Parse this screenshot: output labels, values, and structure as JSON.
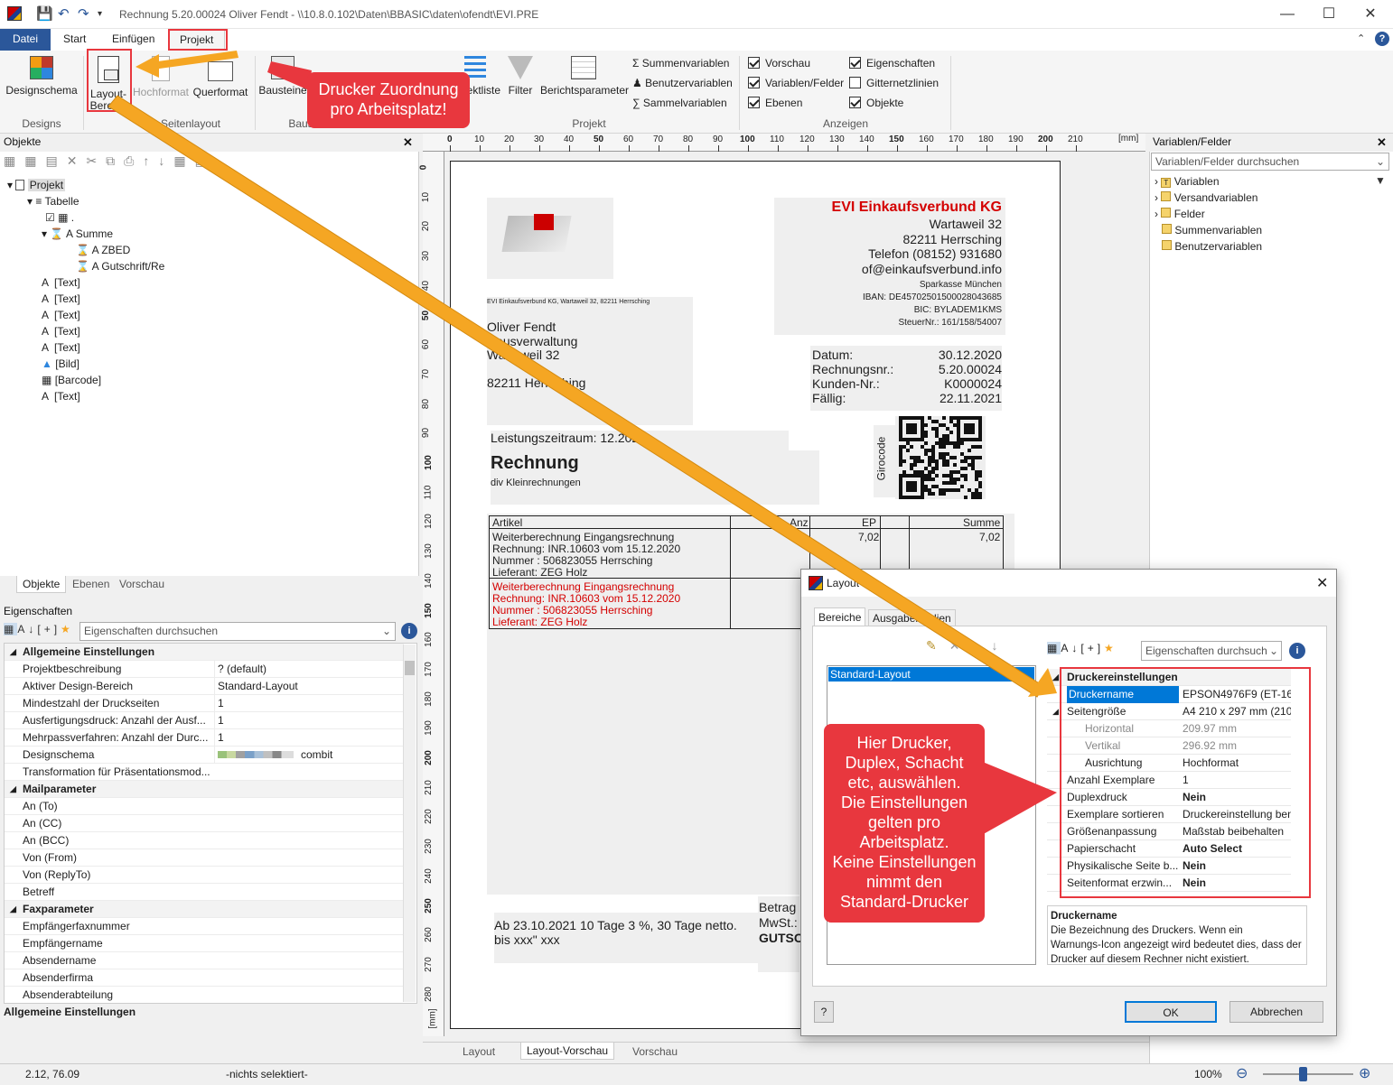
{
  "window": {
    "title": "Rechnung 5.20.00024 Oliver Fendt - \\\\10.8.0.102\\Daten\\BBASIC\\daten\\ofendt\\EVI.PRE",
    "min": "—",
    "max": "☐",
    "close": "✕",
    "help": "?"
  },
  "tabs": [
    "Datei",
    "Start",
    "Einfügen",
    "Projekt"
  ],
  "ribbon": {
    "designschema": "Designschema",
    "layout_line1": "Layout-",
    "layout_line2": "Bereich",
    "hochformat": "Hochformat",
    "querformat": "Querformat",
    "bausteine": "Bausteine",
    "objektliste": "Objektliste",
    "filter": "Filter",
    "berichtsparameter": "Berichtsparameter",
    "summenvariablen": "Summenvariablen",
    "benutzervariablen": "Benutzervariablen",
    "sammelvariablen": "Sammelvariablen",
    "vorschau": "Vorschau",
    "variablen_felder": "Variablen/Felder",
    "ebenen": "Ebenen",
    "eigenschaften": "Eigenschaften",
    "gitternetzlinien": "Gitternetzlinien",
    "objekte": "Objekte",
    "grp_designs": "Designs",
    "grp_seitenlayout": "Seitenlayout",
    "grp_bausteine": "Bausteine",
    "grp_projekt": "Projekt",
    "grp_anzeigen": "Anzeigen"
  },
  "callouts": {
    "top_line1": "Drucker Zuordnung",
    "top_line2": "pro Arbeitsplatz!",
    "dialog": [
      "Hier Drucker,",
      "Duplex, Schacht",
      "etc, auswählen.",
      "Die Einstellungen",
      "gelten pro",
      "Arbeitsplatz.",
      "Keine Einstellungen",
      "nimmt den",
      "Standard-Drucker"
    ]
  },
  "objects_panel": {
    "title": "Objekte",
    "tree": [
      {
        "label": "Projekt"
      },
      {
        "label": "Tabelle"
      },
      {
        "label": "."
      },
      {
        "label": "Summe"
      },
      {
        "label": "ZBED"
      },
      {
        "label": "Gutschrift/Re"
      },
      {
        "label": "[Text]"
      },
      {
        "label": "[Text]"
      },
      {
        "label": "[Text]"
      },
      {
        "label": "[Text]"
      },
      {
        "label": "[Text]"
      },
      {
        "label": "[Bild]"
      },
      {
        "label": "[Barcode]"
      },
      {
        "label": "[Text]"
      }
    ],
    "bottom_tabs": [
      "Objekte",
      "Ebenen",
      "Vorschau"
    ]
  },
  "properties": {
    "title": "Eigenschaften",
    "search_placeholder": "Eigenschaften durchsuchen",
    "rows": [
      {
        "k": "Allgemeine Einstellungen",
        "v": "",
        "cat": true
      },
      {
        "k": "Projektbeschreibung",
        "v": "? (default)"
      },
      {
        "k": "Aktiver Design-Bereich",
        "v": "Standard-Layout"
      },
      {
        "k": "Mindestzahl der Druckseiten",
        "v": "1"
      },
      {
        "k": "Ausfertigungsdruck: Anzahl der Ausf...",
        "v": "1"
      },
      {
        "k": "Mehrpassverfahren: Anzahl der Durc...",
        "v": "1"
      },
      {
        "k": "Designschema",
        "v": "combit"
      },
      {
        "k": "Transformation für Präsentationsmod...",
        "v": ""
      },
      {
        "k": "Mailparameter",
        "v": "",
        "cat": true
      },
      {
        "k": "An (To)",
        "v": ""
      },
      {
        "k": "An (CC)",
        "v": ""
      },
      {
        "k": "An (BCC)",
        "v": ""
      },
      {
        "k": "Von (From)",
        "v": ""
      },
      {
        "k": "Von (ReplyTo)",
        "v": ""
      },
      {
        "k": "Betreff",
        "v": ""
      },
      {
        "k": "Faxparameter",
        "v": "",
        "cat": true
      },
      {
        "k": "Empfängerfaxnummer",
        "v": ""
      },
      {
        "k": "Empfängername",
        "v": ""
      },
      {
        "k": "Absendername",
        "v": ""
      },
      {
        "k": "Absenderfirma",
        "v": ""
      },
      {
        "k": "Absenderabteilung",
        "v": ""
      }
    ],
    "footer": "Allgemeine Einstellungen"
  },
  "ruler": {
    "h_ticks": [
      "0",
      "10",
      "20",
      "30",
      "40",
      "50",
      "60",
      "70",
      "80",
      "90",
      "100",
      "110",
      "120",
      "130",
      "140",
      "150",
      "160",
      "170",
      "180",
      "190",
      "200",
      "210"
    ],
    "h_unit": "[mm]",
    "v_ticks": [
      "0",
      "10",
      "20",
      "30",
      "40",
      "50",
      "60",
      "70",
      "80",
      "90",
      "100",
      "110",
      "120",
      "130",
      "140",
      "150",
      "160",
      "170",
      "180",
      "190",
      "200",
      "210",
      "220",
      "230",
      "240",
      "250",
      "260",
      "270",
      "280"
    ],
    "v_unit": "[mm]"
  },
  "invoice": {
    "company": "EVI Einkaufsverbund KG",
    "company_lines": [
      "Wartaweil 32",
      "82211 Herrsching",
      "Telefon (08152) 931680",
      "of@einkaufsverbund.info"
    ],
    "bank_lines": [
      "Sparkasse München",
      "IBAN: DE45702501500028043685",
      "BIC: BYLADEM1KMS",
      "SteuerNr.: 161/158/54007"
    ],
    "sender_line": "EVI Einkaufsverbund KG, Wartaweil 32, 82211 Herrsching",
    "recipient_lines": [
      "Oliver Fendt",
      "Hausverwaltung",
      "Wartaweil 32",
      "",
      "82211 Herrsching"
    ],
    "meta": [
      {
        "k": "Datum:",
        "v": "30.12.2020"
      },
      {
        "k": "Rechnungsnr.:",
        "v": "5.20.00024"
      },
      {
        "k": "Kunden-Nr.:",
        "v": "K0000024"
      },
      {
        "k": "Fällig:",
        "v": "22.11.2021"
      }
    ],
    "girocode": "Girocode",
    "leistungszeitraum": "Leistungszeitraum: 12.2020",
    "heading": "Rechnung",
    "subheading": "div Kleinrechnungen",
    "table_headers": [
      "Artikel",
      "Anz",
      "EP",
      "Summe"
    ],
    "row1_lines": [
      "Weiterberechnung Eingangsrechnung",
      "Rechnung: INR.10603 vom 15.12.2020",
      "Nummer    : 506823055 Herrsching",
      "Lieferant: ZEG Holz"
    ],
    "row1_ep": "7,02",
    "row1_sum": "7,02",
    "row2_lines": [
      "Weiterberechnung Eingangsrechnung",
      "Rechnung: INR.10603 vom 15.12.2020",
      "Nummer    : 506823055 Herrsching",
      "Lieferant: ZEG Holz"
    ],
    "footer_terms1": "Ab 23.10.2021 10 Tage 3 %, 30 Tage netto.",
    "footer_terms2": "bis xxx\" xxx",
    "betrag": "Betrag",
    "mwst": "MwSt.:",
    "gutsc": "GUTSC"
  },
  "design_tabs": [
    "Layout",
    "Layout-Vorschau",
    "Vorschau"
  ],
  "variables_panel": {
    "title": "Variablen/Felder",
    "search_placeholder": "Variablen/Felder durchsuchen",
    "items": [
      "Variablen",
      "Versandvariablen",
      "Felder",
      "Summenvariablen",
      "Benutzervariablen"
    ]
  },
  "dialog": {
    "title": "Layout",
    "tabs": [
      "Bereiche",
      "Ausgabemedien"
    ],
    "list_item": "Standard-Layout",
    "search_placeholder": "Eigenschaften durchsuch",
    "rows": [
      {
        "k": "Druckereinstellungen",
        "v": "",
        "cat": true
      },
      {
        "k": "Druckername",
        "v": "EPSON4976F9 (ET-16650...",
        "sel": true
      },
      {
        "k": "Seitengröße",
        "v": "A4 210 x 297 mm (210.00..."
      },
      {
        "k": "Horizontal",
        "v": "209.97 mm",
        "sub": true,
        "dim": true
      },
      {
        "k": "Vertikal",
        "v": "296.92 mm",
        "sub": true,
        "dim": true
      },
      {
        "k": "Ausrichtung",
        "v": "Hochformat",
        "sub": true
      },
      {
        "k": "Anzahl Exemplare",
        "v": "1"
      },
      {
        "k": "Duplexdruck",
        "v": "Nein",
        "bold": true
      },
      {
        "k": "Exemplare sortieren",
        "v": "Druckereinstellung ben..."
      },
      {
        "k": "Größenanpassung",
        "v": "Maßstab beibehalten"
      },
      {
        "k": "Papierschacht",
        "v": "Auto Select",
        "bold": true
      },
      {
        "k": "Physikalische Seite b...",
        "v": "Nein",
        "bold": true
      },
      {
        "k": "Seitenformat erzwin...",
        "v": "Nein",
        "bold": true
      }
    ],
    "desc_title": "Druckername",
    "desc_text": [
      "Die Bezeichnung des Druckers. Wenn ein",
      "Warnungs-Icon angezeigt wird bedeutet dies, dass der",
      "Drucker auf diesem Rechner nicht existiert."
    ],
    "ok": "OK",
    "cancel": "Abbrechen",
    "help": "?"
  },
  "status": {
    "coords": "2.12, 76.09",
    "selection": "-nichts selektiert-",
    "zoom": "100%"
  },
  "colors": {
    "accent": "#2b579a",
    "callout": "#e8373e",
    "arrow": "#f5a623",
    "company_red": "#d40000",
    "selection": "#0078d7"
  }
}
